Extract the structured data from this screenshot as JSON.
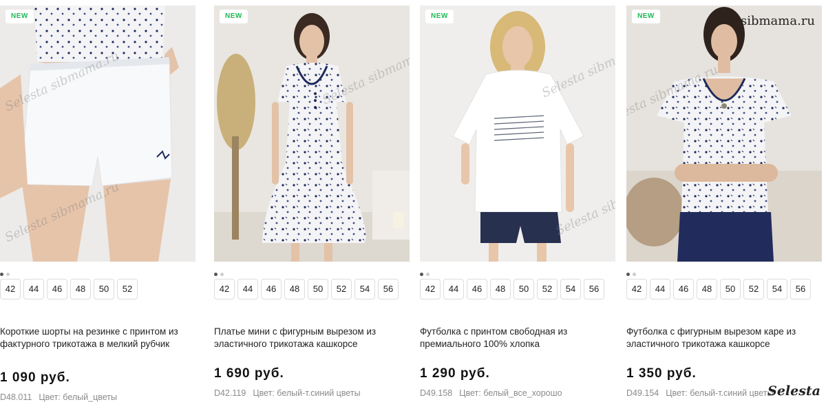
{
  "products": [
    {
      "badge": "NEW",
      "title": "Платье мини с фигурным вырезом из эластичного трикотажа кашкорсе",
      "price": "1 690 руб.",
      "code": "D42.119",
      "color": "Цвет: белый-т.синий цветы",
      "sizes": [
        "42",
        "44",
        "46",
        "48",
        "50",
        "52",
        "54",
        "56"
      ],
      "image_icon": "dress-photo"
    },
    {
      "badge": "NEW",
      "title": "Футболка с принтом свободная из премиального 100% хлопка",
      "price": "1 290 руб.",
      "code": "D49.158",
      "color": "Цвет: белый_все_хорошо",
      "sizes": [
        "42",
        "44",
        "46",
        "48",
        "50",
        "52",
        "54",
        "56"
      ],
      "image_icon": "tshirt-photo"
    },
    {
      "badge": "NEW",
      "title": "Футболка с фигурным вырезом каре из эластичного трикотажа кашкорсе",
      "price": "1 350 руб.",
      "code": "D49.154",
      "color": "Цвет: белый-т.синий цветы",
      "sizes": [
        "42",
        "44",
        "46",
        "48",
        "50",
        "52",
        "54",
        "56"
      ],
      "image_icon": "top-photo"
    },
    {
      "badge": "NEW",
      "title": "Короткие шорты на резинке с принтом из фактурного трикотажа в мелкий рубчик",
      "price": "1 090 руб.",
      "code": "D48.011",
      "color": "Цвет: белый_цветы",
      "sizes": [
        "42",
        "44",
        "46",
        "48",
        "50",
        "52"
      ],
      "image_icon": "shorts-photo"
    }
  ],
  "watermarks": {
    "photo": "Selesta sibmama.ru",
    "site": "sibmama.ru",
    "brand": "Selesta"
  },
  "colors": {
    "badge_text": "#1db954",
    "price": "#111111",
    "meta": "#8a8a8a",
    "pattern": "#1e2a5a"
  }
}
